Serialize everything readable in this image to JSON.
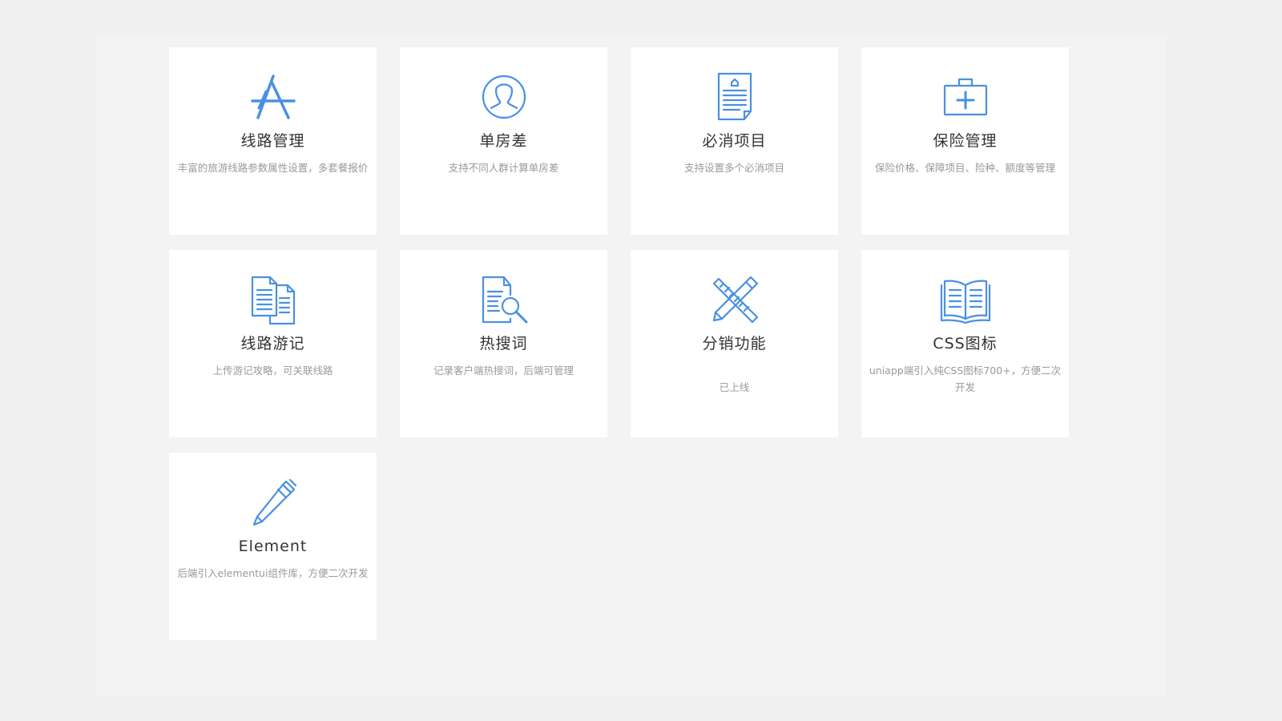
{
  "accent_color": "#4a90e2",
  "cards": [
    {
      "icon": "app-store-icon",
      "title": "线路管理",
      "desc": "丰富的旅游线路参数属性设置，多套餐报价"
    },
    {
      "icon": "user-icon",
      "title": "单房差",
      "desc": "支持不同人群计算单房差"
    },
    {
      "icon": "document-icon",
      "title": "必消项目",
      "desc": "支持设置多个必消项目"
    },
    {
      "icon": "medical-kit-icon",
      "title": "保险管理",
      "desc": "保险价格、保障项目、险种、额度等管理"
    },
    {
      "icon": "documents-icon",
      "title": "线路游记",
      "desc": "上传游记攻略，可关联线路"
    },
    {
      "icon": "document-search-icon",
      "title": "热搜词",
      "desc": "记录客户端热搜词，后端可管理"
    },
    {
      "icon": "ruler-pencil-icon",
      "title": "分销功能",
      "desc": "已上线"
    },
    {
      "icon": "open-book-icon",
      "title": "CSS图标",
      "desc": "uniapp端引入纯CSS图标700+，方便二次开发"
    },
    {
      "icon": "pen-icon",
      "title": "Element",
      "desc": "后端引入elementui组件库，方便二次开发"
    }
  ]
}
